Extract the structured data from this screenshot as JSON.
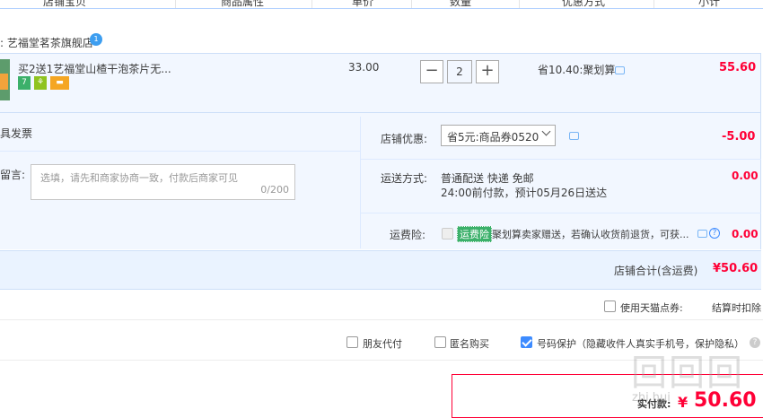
{
  "header": {
    "col_item": "店铺宝贝",
    "col_attr": "商品属性",
    "col_price": "单价",
    "col_qty": "数量",
    "col_promo": "优惠方式",
    "col_subtotal": "小计"
  },
  "shop": {
    "name": ": 艺福堂茗茶旗舰店",
    "ww_icon": "wangwang-icon"
  },
  "item": {
    "title": "买2送1艺福堂山楂干泡茶片无...",
    "price": "33.00",
    "quantity": "2",
    "minus_label": "−",
    "plus_label": "+",
    "promo": "省10.40:聚划算",
    "subtotal": "55.60",
    "badges": [
      "7",
      "⚘",
      "▬"
    ]
  },
  "options": {
    "invoice_label": "具发票",
    "message_label": "留言:",
    "message_placeholder": "选填，请先和商家协商一致，付款后商家可见",
    "message_count": "0/200",
    "shop_discount_label": "店铺优惠:",
    "shop_discount_value": "省5元:商品券0520",
    "shop_discount_amount": "-5.00",
    "shipping_label": "运送方式:",
    "shipping_method": "普通配送 快递 免邮",
    "shipping_eta": "24:00前付款，预计05月26日送达",
    "shipping_amount": "0.00",
    "insurance_label": "运费险:",
    "insurance_badge": "运费险",
    "insurance_text": "聚划算卖家赠送，若确认收货前退货，可获...",
    "insurance_amount": "0.00"
  },
  "shop_total": {
    "label": "店铺合计(含运费)",
    "value": "¥50.60"
  },
  "coupon": {
    "label": "使用天猫点券:",
    "note": "结算时扣除"
  },
  "checkout_options": {
    "friend_pay": "朋友代付",
    "anonymous": "匿名购买",
    "number_protect": "号码保护（隐藏收件人真实手机号，保护隐私）"
  },
  "payment": {
    "label": "实付款:",
    "currency": "¥",
    "value": "50.60",
    "watermark": "zhi.hui"
  },
  "colors": {
    "accent_red": "#ff0036",
    "accent_blue": "#3d8bff",
    "panel_bg": "#f2f7ff"
  }
}
